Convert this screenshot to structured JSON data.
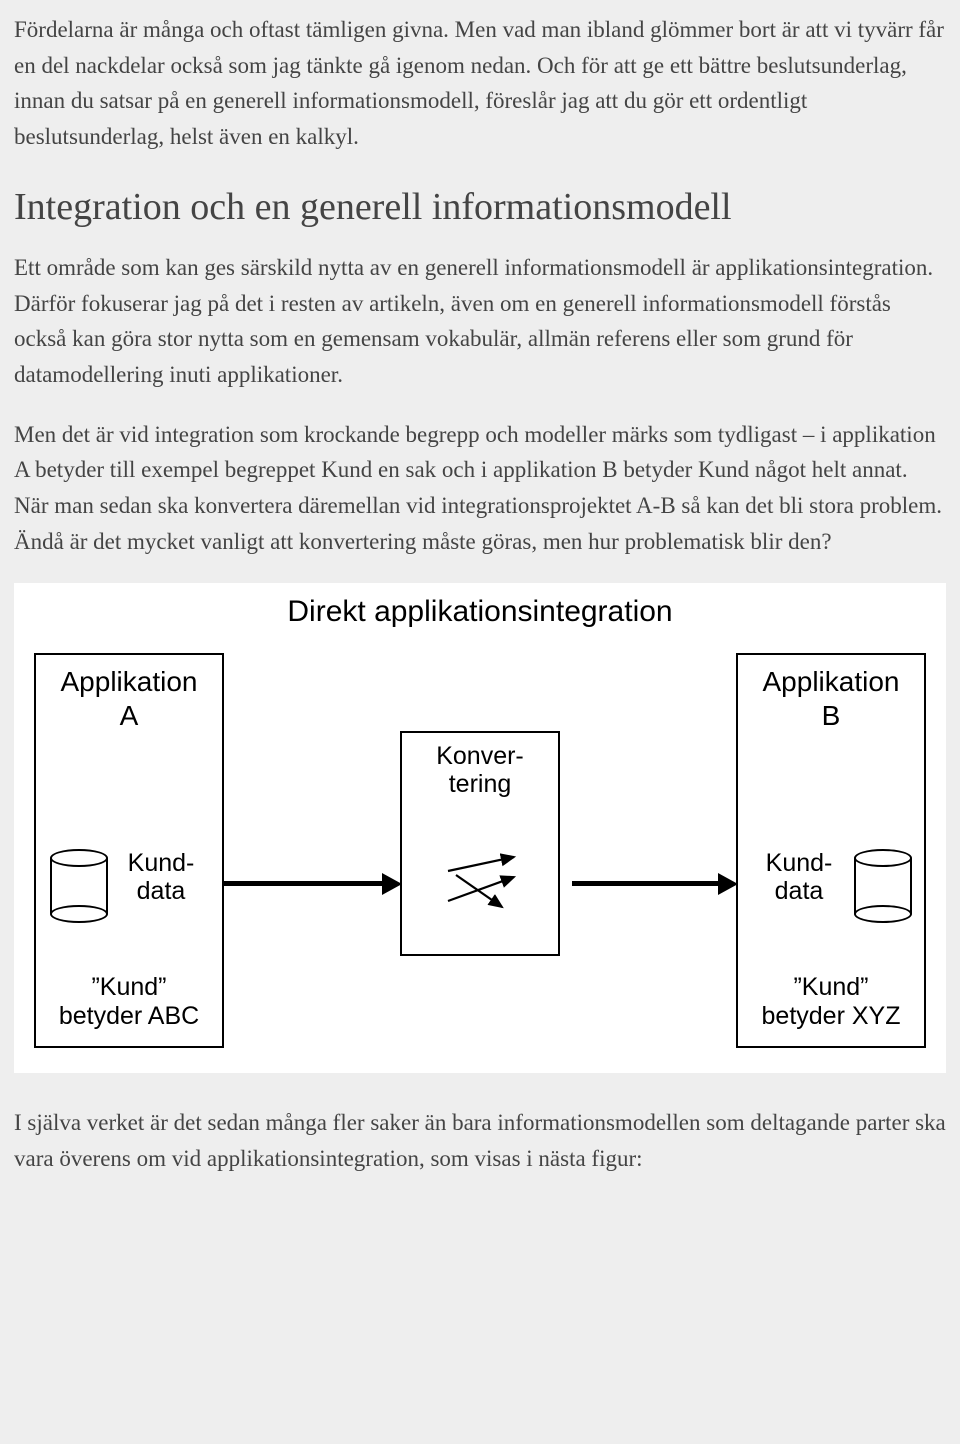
{
  "para1": "Fördelarna är många och oftast tämligen givna. Men vad man ibland glömmer bort är att vi tyvärr får en del nackdelar också som jag tänkte gå igenom nedan. Och för att ge ett bättre beslutsunderlag, innan du satsar på en generell informationsmodell, föreslår jag att du gör ett ordentligt beslutsunderlag, helst även en kalkyl.",
  "heading": "Integration och en generell informationsmodell",
  "para2": "Ett område som kan ges särskild nytta av en generell informationsmodell är applikationsintegration. Därför fokuserar jag på det i resten av artikeln, även om en generell informationsmodell förstås också kan göra stor nytta som en gemensam vokabulär, allmän referens eller som grund för datamodellering inuti applikationer.",
  "para3": "Men det är vid integration som krockande begrepp och modeller märks som tydligast – i applikation A betyder till exempel begreppet Kund en sak och i applikation B betyder Kund något helt annat. När man sedan ska konvertera däremellan vid integrationsprojektet A-B så kan det bli stora problem. Ändå är det mycket vanligt att konvertering måste göras, men hur problematisk blir den?",
  "diagram": {
    "title": "Direkt applikationsintegration",
    "appA": {
      "name_line1": "Applikation",
      "name_line2": "A",
      "data_label_line1": "Kund-",
      "data_label_line2": "data",
      "meaning_line1": "”Kund”",
      "meaning_line2": "betyder ABC"
    },
    "conversion": {
      "label_line1": "Konver-",
      "label_line2": "tering"
    },
    "appB": {
      "name_line1": "Applikation",
      "name_line2": "B",
      "data_label_line1": "Kund-",
      "data_label_line2": "data",
      "meaning_line1": "”Kund”",
      "meaning_line2": "betyder XYZ"
    }
  },
  "para4": "I själva verket är det sedan många fler saker än bara informationsmodellen som deltagande parter ska vara överens om vid applikationsintegration, som visas i nästa figur:"
}
